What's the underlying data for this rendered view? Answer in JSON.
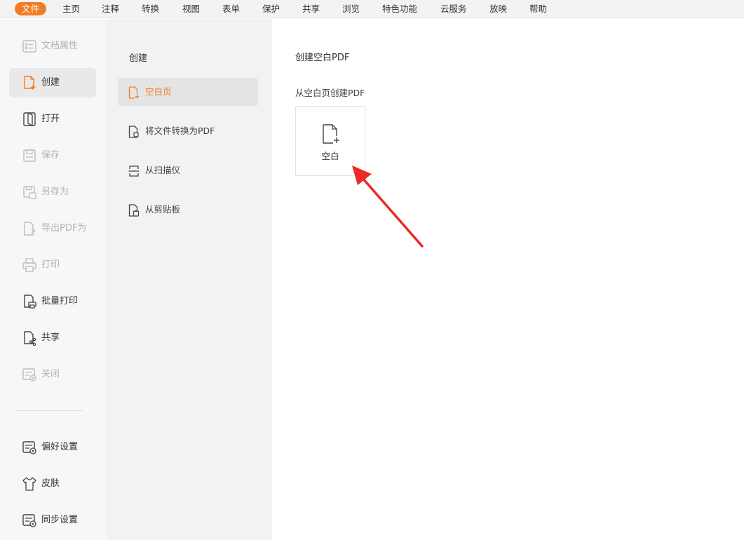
{
  "menu": {
    "items": [
      "文件",
      "主页",
      "注释",
      "转换",
      "视图",
      "表单",
      "保护",
      "共享",
      "浏览",
      "特色功能",
      "云服务",
      "放映",
      "帮助"
    ],
    "active_index": 0
  },
  "sidebar": {
    "items": [
      {
        "label": "文档属性",
        "icon": "document-properties-icon",
        "enabled": false
      },
      {
        "label": "创建",
        "icon": "create-icon",
        "enabled": true,
        "active": true
      },
      {
        "label": "打开",
        "icon": "open-icon",
        "enabled": true
      },
      {
        "label": "保存",
        "icon": "save-icon",
        "enabled": false
      },
      {
        "label": "另存为",
        "icon": "save-as-icon",
        "enabled": false
      },
      {
        "label": "导出PDF为",
        "icon": "export-icon",
        "enabled": false
      },
      {
        "label": "打印",
        "icon": "print-icon",
        "enabled": false
      },
      {
        "label": "批量打印",
        "icon": "batch-print-icon",
        "enabled": true
      },
      {
        "label": "共享",
        "icon": "share-icon",
        "enabled": true
      },
      {
        "label": "关闭",
        "icon": "close-doc-icon",
        "enabled": false
      }
    ],
    "bottom_items": [
      {
        "label": "偏好设置",
        "icon": "preferences-icon"
      },
      {
        "label": "皮肤",
        "icon": "skin-icon"
      },
      {
        "label": "同步设置",
        "icon": "sync-settings-icon"
      }
    ]
  },
  "create_panel": {
    "title": "创建",
    "items": [
      {
        "label": "空白页",
        "icon": "blank-page-icon",
        "active": true
      },
      {
        "label": "将文件转换为PDF",
        "icon": "convert-file-icon"
      },
      {
        "label": "从扫描仪",
        "icon": "scanner-icon"
      },
      {
        "label": "从剪贴板",
        "icon": "clipboard-icon"
      }
    ]
  },
  "content": {
    "title": "创建空白PDF",
    "subtitle": "从空白页创建PDF",
    "card_label": "空白",
    "card_icon": "blank-document-plus-icon"
  },
  "colors": {
    "accent": "#f07d25",
    "annotation_arrow": "#ee2a24"
  }
}
